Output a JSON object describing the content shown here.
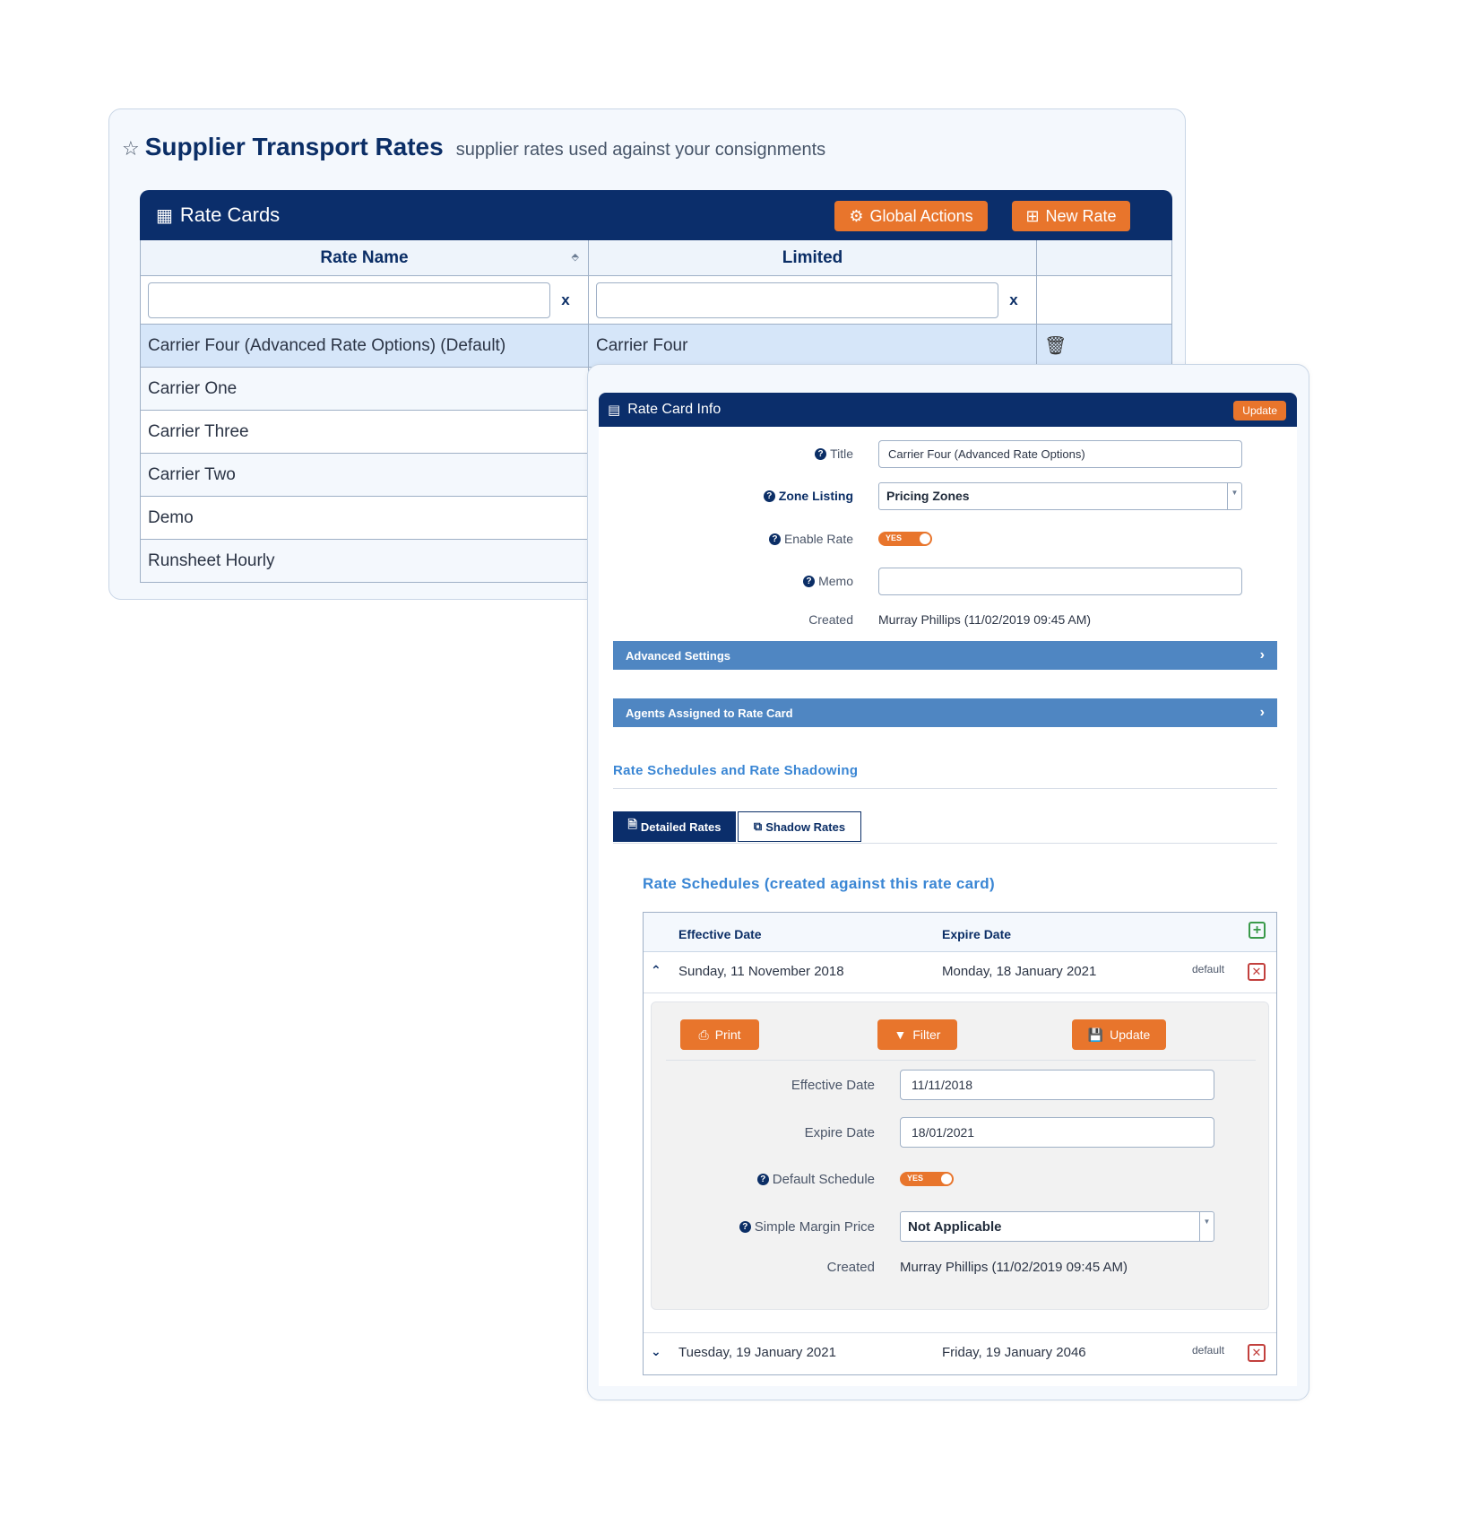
{
  "page": {
    "title": "Supplier Transport Rates",
    "subtitle": "supplier rates used against your consignments"
  },
  "rate_cards": {
    "title": "Rate Cards",
    "global_actions_label": "Global Actions",
    "new_rate_label": "New Rate",
    "columns": [
      "Rate Name",
      "Limited",
      ""
    ],
    "clear_label": "x",
    "rows": [
      {
        "name": "Carrier Four (Advanced Rate Options) (Default)",
        "limited": "Carrier Four"
      },
      {
        "name": "Carrier One",
        "limited": ""
      },
      {
        "name": "Carrier Three",
        "limited": ""
      },
      {
        "name": "Carrier Two",
        "limited": ""
      },
      {
        "name": "Demo",
        "limited": ""
      },
      {
        "name": "Runsheet Hourly",
        "limited": ""
      }
    ]
  },
  "rate_card_info": {
    "title": "Rate Card Info",
    "update_label": "Update",
    "fields": {
      "title_label": "Title",
      "title_value": "Carrier Four (Advanced Rate Options)",
      "zone_label": "Zone Listing",
      "zone_value": "Pricing Zones",
      "enable_label": "Enable Rate",
      "enable_value": "YES",
      "memo_label": "Memo",
      "memo_value": "",
      "created_label": "Created",
      "created_value": "Murray Phillips (11/02/2019 09:45 AM)"
    },
    "accordions": [
      "Advanced Settings",
      "Agents Assigned to Rate Card"
    ],
    "shadowing_heading": "Rate Schedules and Rate Shadowing",
    "tabs": [
      "Detailed Rates",
      "Shadow Rates"
    ]
  },
  "schedules": {
    "title": "Rate Schedules (created against this rate card)",
    "col_effective": "Effective Date",
    "col_expire": "Expire Date",
    "rows": [
      {
        "effective": "Sunday, 11 November 2018",
        "expire": "Monday, 18 January 2021",
        "tag": "default"
      },
      {
        "effective": "Tuesday, 19 January 2021",
        "expire": "Friday, 19 January 2046",
        "tag": "default"
      }
    ],
    "detail": {
      "print_label": "Print",
      "filter_label": "Filter",
      "update_label": "Update",
      "effective_label": "Effective Date",
      "effective_value": "11/11/2018",
      "expire_label": "Expire Date",
      "expire_value": "18/01/2021",
      "default_label": "Default Schedule",
      "default_value": "YES",
      "margin_label": "Simple Margin Price",
      "margin_value": "Not Applicable",
      "created_label": "Created",
      "created_value": "Murray Phillips (11/02/2019 09:45 AM)"
    }
  },
  "colors": {
    "navy": "#0b2e6b",
    "orange": "#e8752c",
    "accordion_blue": "#4f86c2",
    "heading_blue": "#3a86d4",
    "selected_row": "#d6e6f9"
  }
}
